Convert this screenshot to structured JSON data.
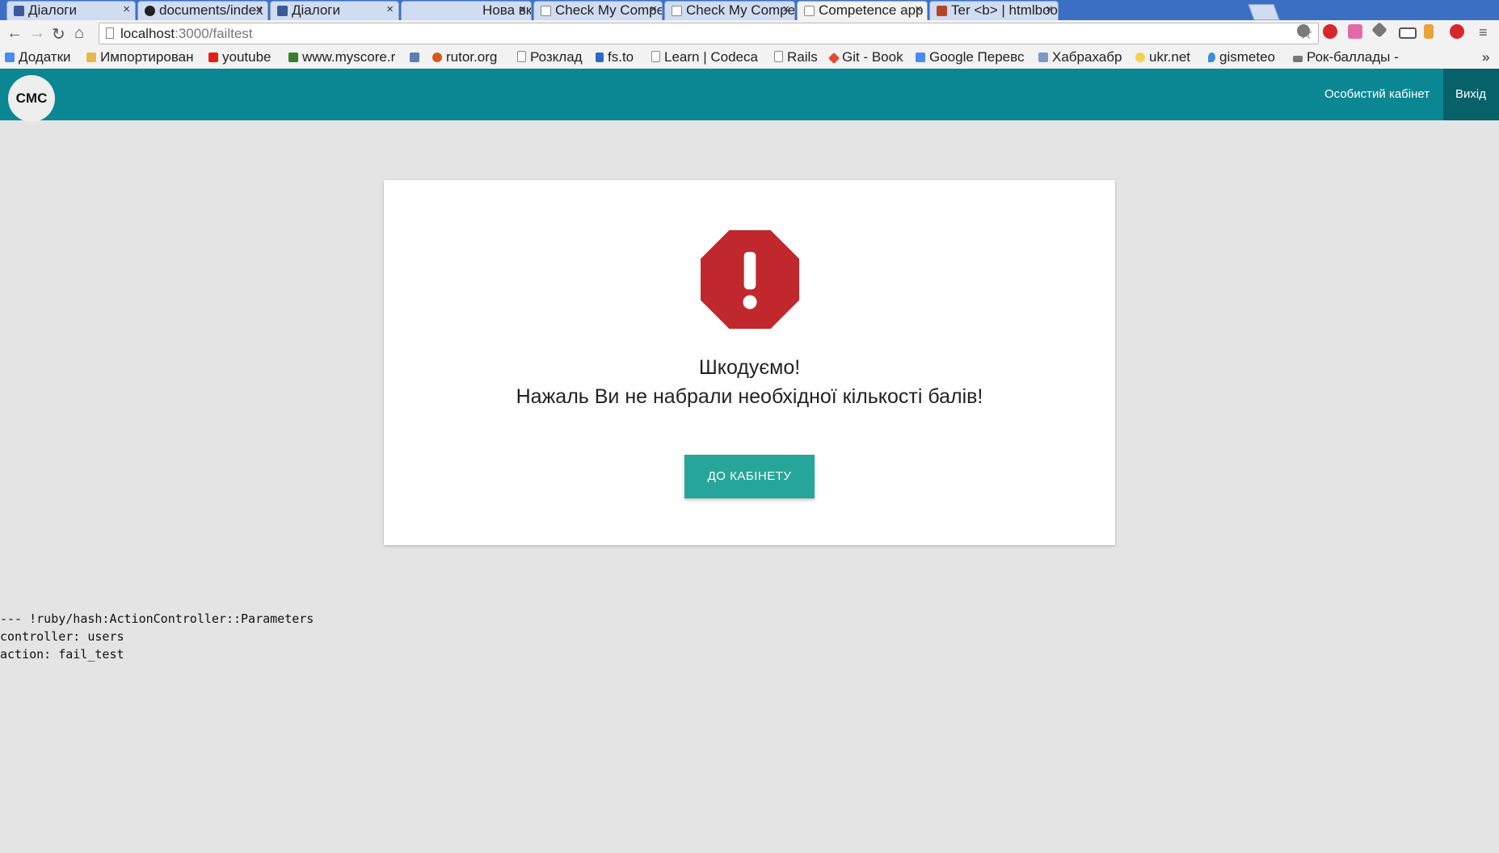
{
  "browser": {
    "tabs": [
      {
        "label": "Діалоги",
        "icon": "vk-icon"
      },
      {
        "label": "documents/index",
        "icon": "github-icon"
      },
      {
        "label": "Діалоги",
        "icon": "vk-icon"
      },
      {
        "label": "Нова вкладка",
        "icon": "none"
      },
      {
        "label": "Check My Compe",
        "icon": "page-icon"
      },
      {
        "label": "Check My Compe",
        "icon": "page-icon"
      },
      {
        "label": "Competence app",
        "icon": "page-icon"
      },
      {
        "label": "Ter <b> | htmlboo",
        "icon": "html-icon"
      }
    ],
    "tab_close": "×",
    "url_host": "localhost",
    "url_path": ":3000/failtest",
    "bookmarks": [
      {
        "label": "Додатки",
        "color": "#4a8af4"
      },
      {
        "label": "Импортирован",
        "color": "#e8b84b"
      },
      {
        "label": "youtube",
        "color": "#e62117"
      },
      {
        "label": "www.myscore.r",
        "color": "#3a7d2c"
      },
      {
        "label": "",
        "color": "#5b7fb5"
      },
      {
        "label": "rutor.org",
        "color": "#d55a1c"
      },
      {
        "label": "Розклад",
        "color": "#ffffff"
      },
      {
        "label": "fs.to",
        "color": "#2a6ac8"
      },
      {
        "label": "Learn | Codeca",
        "color": "#ffffff"
      },
      {
        "label": "Rails",
        "color": "#ffffff"
      },
      {
        "label": "Git - Book",
        "color": "#e44c30"
      },
      {
        "label": "Google Перевс",
        "color": "#4a8af4"
      },
      {
        "label": "Хабрахабр",
        "color": "#7a9ac7"
      },
      {
        "label": "ukr.net",
        "color": "#f3d34a"
      },
      {
        "label": "gismeteo",
        "color": "#3c8ed8"
      },
      {
        "label": "Рок-баллады -",
        "color": "#777777"
      }
    ],
    "bookmarks_more": "»"
  },
  "app": {
    "logo": "CMC",
    "nav": [
      {
        "label": "Особистий кабінет"
      },
      {
        "label": "Вихід"
      }
    ],
    "colors": {
      "header": "#0b8693",
      "button": "#26a69a",
      "error": "#c0282d"
    }
  },
  "card": {
    "line1": "Шкодуємо!",
    "line2": "Нажаль Ви не набрали необхідної кількості балів!",
    "button": "ДО КАБІНЕТУ"
  },
  "debug": {
    "lines": [
      "--- !ruby/hash:ActionController::Parameters",
      "controller: users",
      "action: fail_test"
    ]
  }
}
